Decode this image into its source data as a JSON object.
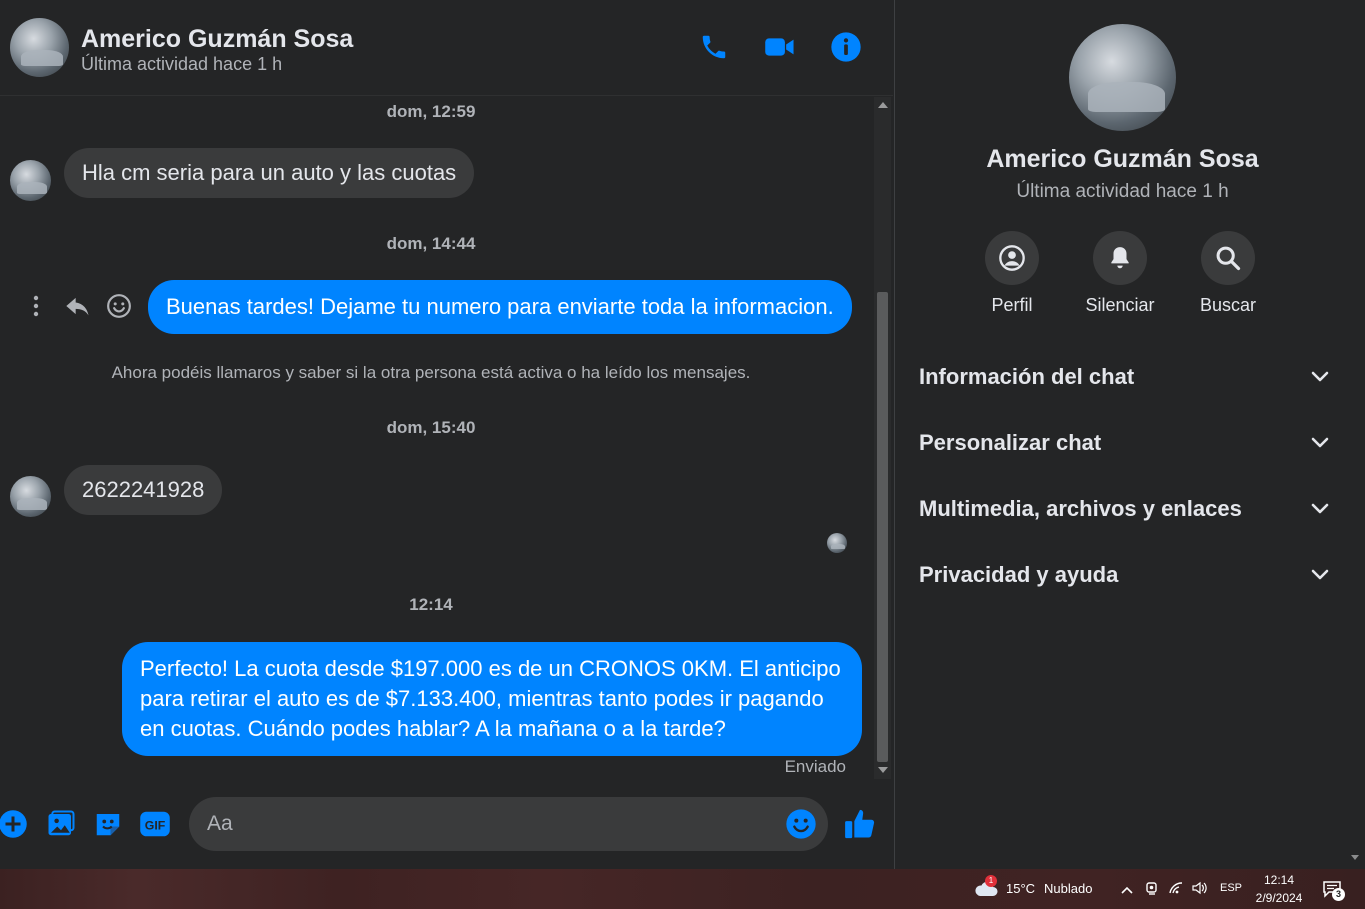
{
  "contact": {
    "name": "Americo Guzmán Sosa",
    "status": "Última actividad hace 1 h"
  },
  "header": {
    "icons": [
      "phone-icon",
      "video-icon",
      "info-icon"
    ]
  },
  "messages": [
    {
      "type": "timestamp",
      "text": "dom, 12:59"
    },
    {
      "type": "incoming",
      "text": "Hla cm seria para un auto y las cuotas"
    },
    {
      "type": "timestamp",
      "text": "dom, 14:44"
    },
    {
      "type": "outgoing",
      "text": "Buenas tardes! Dejame tu numero para enviarte toda la informacion."
    },
    {
      "type": "notice",
      "text": "Ahora podéis llamaros y saber si la otra persona está activa o ha leído los mensajes."
    },
    {
      "type": "timestamp",
      "text": "dom, 15:40"
    },
    {
      "type": "incoming",
      "text": "2622241928"
    },
    {
      "type": "timestamp",
      "text": "12:14"
    },
    {
      "type": "outgoing",
      "text": "Perfecto! La cuota desde $197.000 es de un CRONOS 0KM. El anticipo para retirar el auto es de $7.133.400, mientras tanto podes ir pagando en cuotas. Cuándo podes hablar? A la mañana o a la tarde?"
    },
    {
      "type": "delivery",
      "text": "Enviado"
    }
  ],
  "composer": {
    "placeholder": "Aa"
  },
  "info_panel": {
    "actions": [
      {
        "label": "Perfil",
        "icon": "profile-icon"
      },
      {
        "label": "Silenciar",
        "icon": "bell-icon"
      },
      {
        "label": "Buscar",
        "icon": "search-icon"
      }
    ],
    "sections": [
      {
        "label": "Información del chat"
      },
      {
        "label": "Personalizar chat"
      },
      {
        "label": "Multimedia, archivos y enlaces"
      },
      {
        "label": "Privacidad y ayuda"
      }
    ]
  },
  "taskbar": {
    "temperature": "15°C",
    "weather": "Nublado",
    "weather_badge": "1",
    "language": "ESP",
    "time": "12:14",
    "date": "2/9/2024",
    "notification_count": "3"
  },
  "colors": {
    "accent": "#0084ff",
    "background": "#242526",
    "incoming_bubble": "#3a3b3c"
  }
}
